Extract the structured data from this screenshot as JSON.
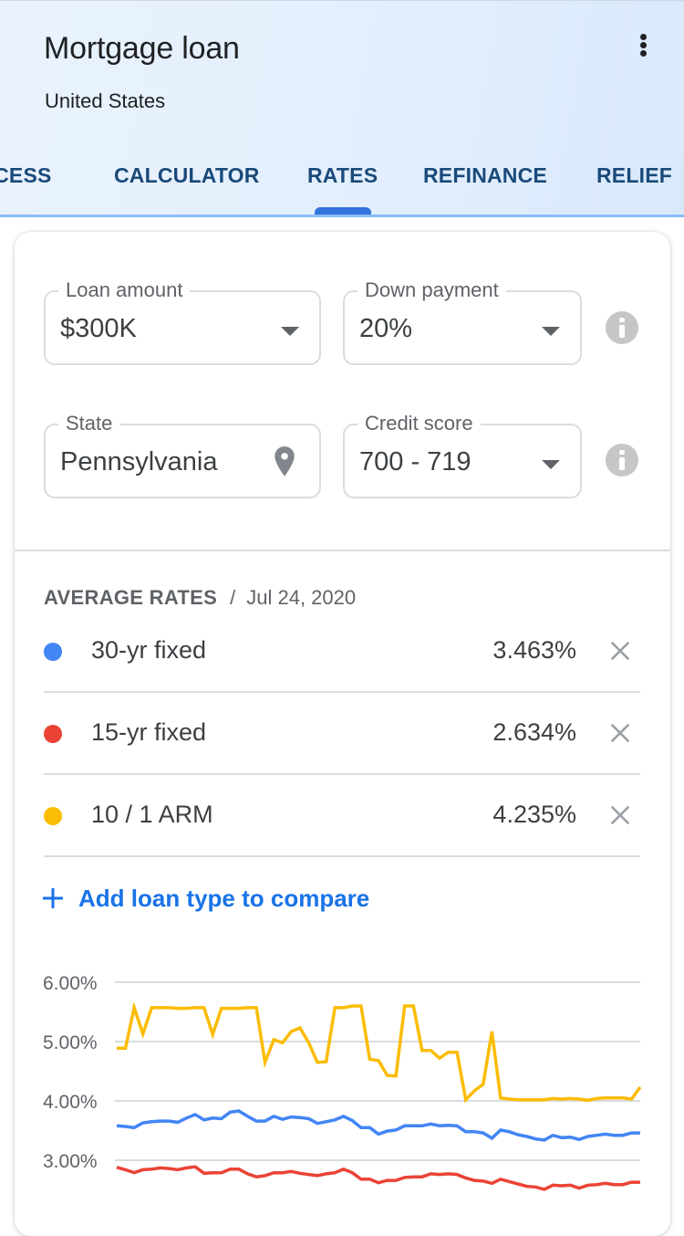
{
  "header": {
    "title": "Mortgage loan",
    "subtitle": "United States",
    "menu_icon": "more-vert-icon"
  },
  "tabs": [
    {
      "label": "PROCESS",
      "visible_label": "OCESS",
      "active": false
    },
    {
      "label": "CALCULATOR",
      "active": false
    },
    {
      "label": "RATES",
      "active": true
    },
    {
      "label": "REFINANCE",
      "active": false
    },
    {
      "label": "RELIEF",
      "active": false
    }
  ],
  "form": {
    "loan_amount": {
      "label": "Loan amount",
      "value": "$300K",
      "icon": "dropdown-caret-icon"
    },
    "down_payment": {
      "label": "Down payment",
      "value": "20%",
      "icon": "dropdown-caret-icon"
    },
    "state": {
      "label": "State",
      "value": "Pennsylvania",
      "icon": "location-pin-icon"
    },
    "credit_score": {
      "label": "Credit score",
      "value": "700 - 719",
      "icon": "dropdown-caret-icon"
    }
  },
  "average_rates": {
    "title": "AVERAGE RATES",
    "separator": "/",
    "date": "Jul 24, 2020",
    "rows": [
      {
        "name": "30-yr fixed",
        "rate": "3.463%",
        "color": "#4285f4"
      },
      {
        "name": "15-yr fixed",
        "rate": "2.634%",
        "color": "#ea4335"
      },
      {
        "name": "10 / 1 ARM",
        "rate": "4.235%",
        "color": "#fbbc04"
      }
    ],
    "add_label": "Add loan type to compare"
  },
  "colors": {
    "accent": "#1a73e8",
    "tab_text": "#1a4a7a",
    "tab_indicator": "#3273dc",
    "grid": "#dadce0"
  },
  "chart_data": {
    "type": "line",
    "title": "",
    "xlabel": "",
    "ylabel": "",
    "y_ticks": [
      "6.00%",
      "5.00%",
      "4.00%",
      "3.00%"
    ],
    "y_tick_values": [
      6,
      5,
      4,
      3
    ],
    "ylim": [
      2.45,
      6.0
    ],
    "grid": true,
    "series": [
      {
        "name": "10 / 1 ARM",
        "color": "#fbbc04",
        "values": [
          4.89,
          4.89,
          5.57,
          5.13,
          5.57,
          5.57,
          5.57,
          5.56,
          5.56,
          5.57,
          5.57,
          5.12,
          5.56,
          5.56,
          5.56,
          5.57,
          5.57,
          4.65,
          5.03,
          4.98,
          5.17,
          5.23,
          4.98,
          4.65,
          4.66,
          5.57,
          5.57,
          5.6,
          5.6,
          4.7,
          4.68,
          4.43,
          4.42,
          5.6,
          5.6,
          4.85,
          4.85,
          4.72,
          4.82,
          4.82,
          4.02,
          4.17,
          4.28,
          5.17,
          4.05,
          4.03,
          4.02,
          4.02,
          4.02,
          4.02,
          4.04,
          4.03,
          4.04,
          4.03,
          4.01,
          4.04,
          4.05,
          4.05,
          4.05,
          4.03,
          4.23
        ]
      },
      {
        "name": "30-yr fixed",
        "color": "#4285f4",
        "values": [
          3.58,
          3.57,
          3.55,
          3.63,
          3.65,
          3.66,
          3.66,
          3.64,
          3.71,
          3.77,
          3.68,
          3.71,
          3.7,
          3.81,
          3.83,
          3.74,
          3.66,
          3.66,
          3.74,
          3.69,
          3.73,
          3.72,
          3.7,
          3.62,
          3.65,
          3.68,
          3.74,
          3.67,
          3.55,
          3.55,
          3.44,
          3.49,
          3.51,
          3.58,
          3.58,
          3.58,
          3.61,
          3.58,
          3.59,
          3.58,
          3.48,
          3.48,
          3.46,
          3.37,
          3.51,
          3.48,
          3.43,
          3.4,
          3.36,
          3.34,
          3.42,
          3.38,
          3.39,
          3.35,
          3.4,
          3.42,
          3.44,
          3.42,
          3.42,
          3.46,
          3.46
        ]
      },
      {
        "name": "15-yr fixed",
        "color": "#ea4335",
        "values": [
          2.88,
          2.84,
          2.79,
          2.84,
          2.85,
          2.87,
          2.86,
          2.84,
          2.87,
          2.89,
          2.78,
          2.79,
          2.79,
          2.85,
          2.85,
          2.77,
          2.72,
          2.74,
          2.79,
          2.79,
          2.81,
          2.78,
          2.76,
          2.74,
          2.77,
          2.79,
          2.85,
          2.79,
          2.68,
          2.68,
          2.62,
          2.66,
          2.66,
          2.71,
          2.72,
          2.72,
          2.77,
          2.76,
          2.77,
          2.76,
          2.7,
          2.66,
          2.65,
          2.61,
          2.68,
          2.64,
          2.6,
          2.56,
          2.55,
          2.51,
          2.58,
          2.57,
          2.58,
          2.53,
          2.58,
          2.59,
          2.61,
          2.59,
          2.59,
          2.63,
          2.63
        ]
      }
    ]
  }
}
